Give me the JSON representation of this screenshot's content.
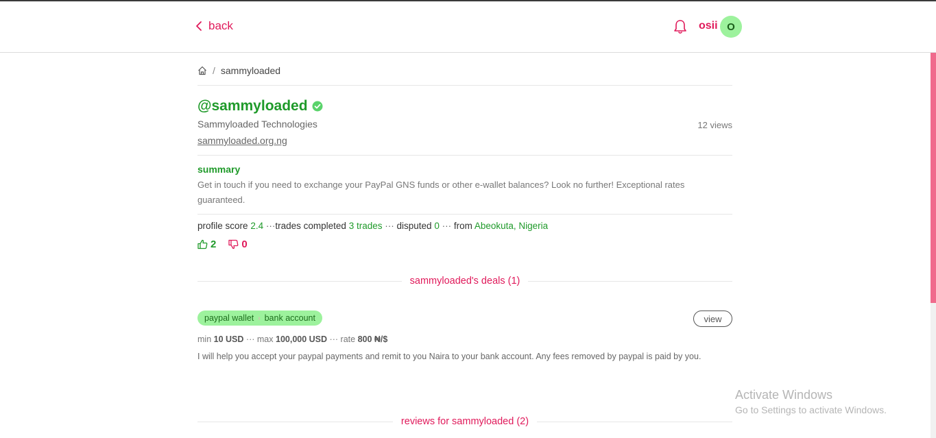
{
  "header": {
    "back_label": "back",
    "user_name": "osii",
    "avatar_initial": "O"
  },
  "breadcrumb": {
    "current": "sammyloaded",
    "separator": "/"
  },
  "profile": {
    "username": "@sammyloaded",
    "company": "Sammyloaded Technologies",
    "website": "sammyloaded.org.ng",
    "views": "12 views",
    "summary_title": "summary",
    "summary_text": "Get in touch if you need to exchange your PayPal GNS funds or other e-wallet balances? Look no further! Exceptional rates guaranteed.",
    "stats": {
      "score_label": "profile score",
      "score_value": "2.4",
      "trades_label": "trades completed",
      "trades_value": "3 trades",
      "disputed_label": "disputed",
      "disputed_value": "0",
      "from_label": "from",
      "from_value": "Abeokuta, Nigeria",
      "separator": "···"
    },
    "upvotes": "2",
    "downvotes": "0"
  },
  "deals_section": {
    "title": "sammyloaded's deals (1)",
    "deals": [
      {
        "from": "paypal wallet",
        "to": "bank account",
        "view_label": "view",
        "min_label": "min",
        "min_value": "10 USD",
        "max_label": "max",
        "max_value": "100,000 USD",
        "rate_label": "rate",
        "rate_value": "800 ₦/$",
        "description": "I will help you accept your paypal payments and remit to you Naira to your bank account. Any fees removed by paypal is paid by you."
      }
    ]
  },
  "reviews_section": {
    "title": "reviews for sammyloaded (2)"
  },
  "watermark": {
    "line1": "Activate Windows",
    "line2": "Go to Settings to activate Windows."
  },
  "colors": {
    "accent_pink": "#e0195a",
    "accent_green": "#1f9a2a",
    "tag_green": "#9df29d"
  }
}
